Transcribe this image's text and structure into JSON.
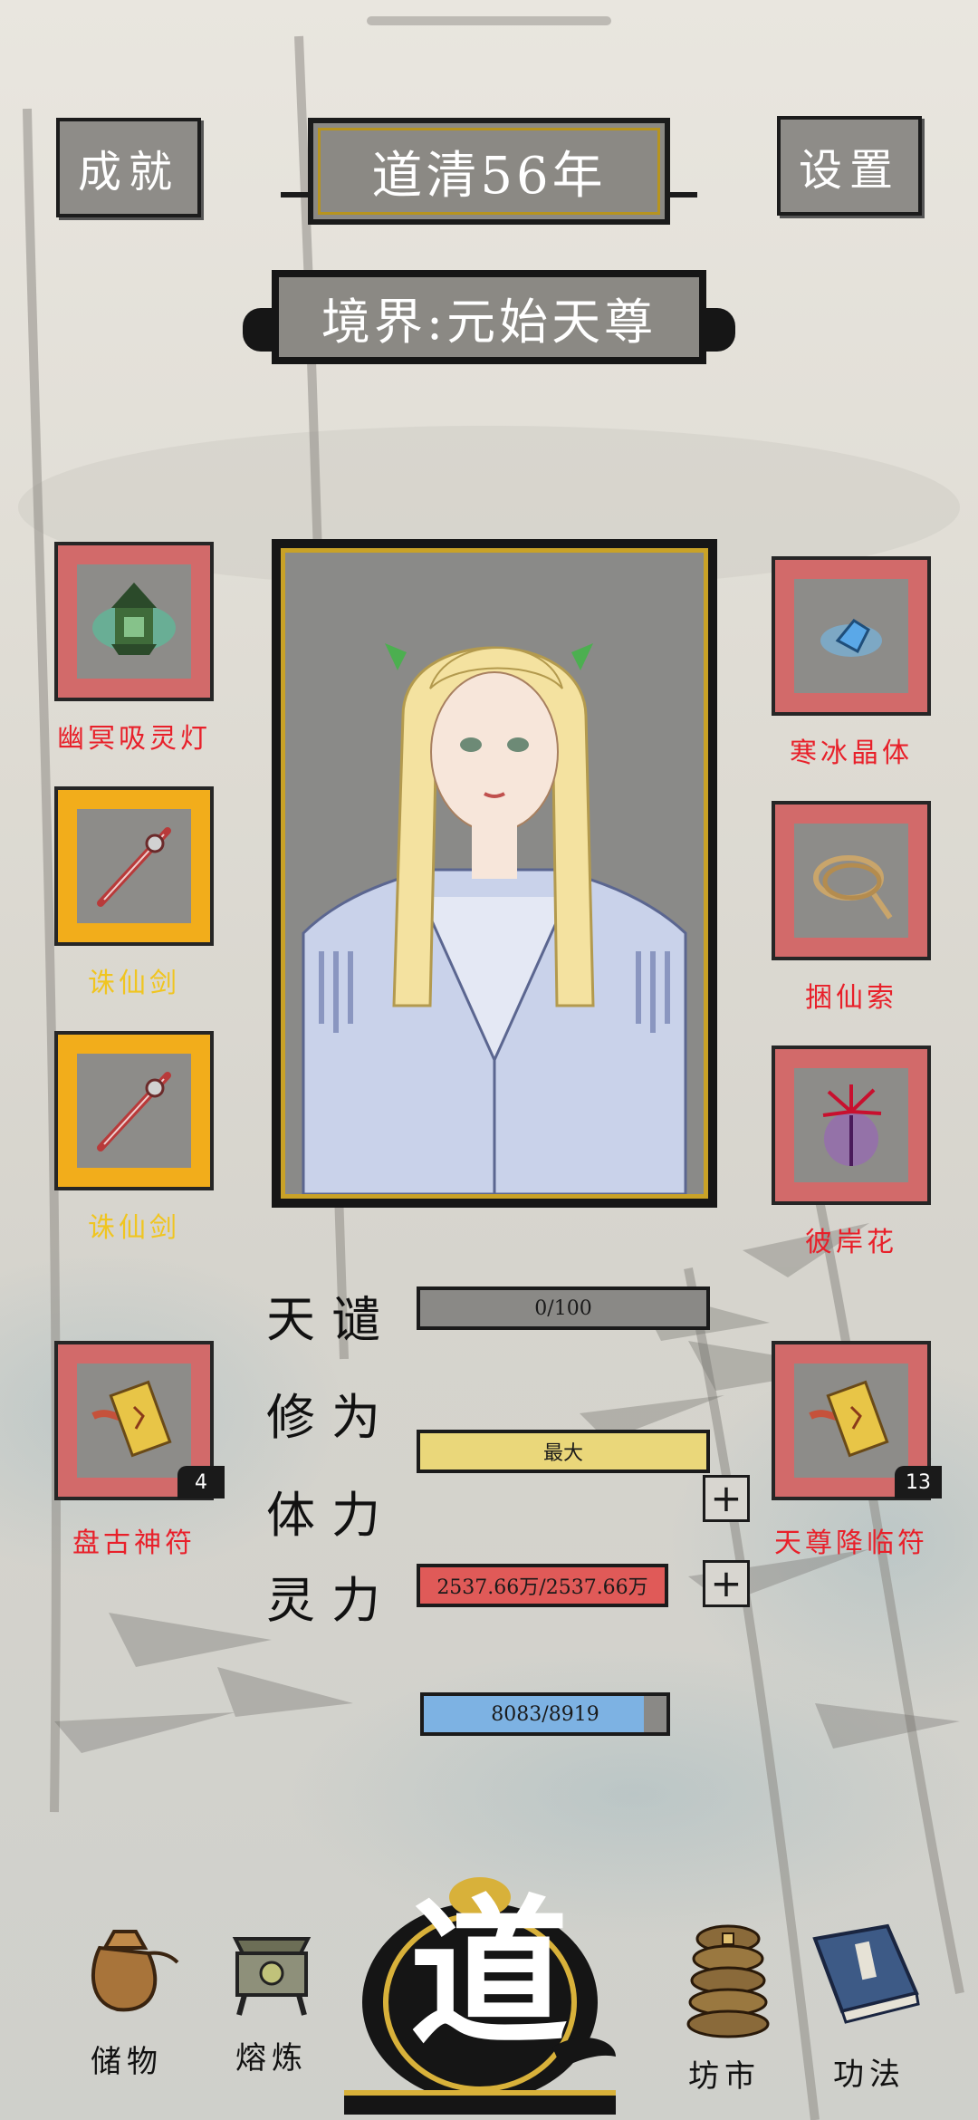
{
  "header": {
    "achievements_label": "成就",
    "year_title": "道清56年",
    "settings_label": "设置",
    "realm_title": "境界:元始天尊"
  },
  "left_items": [
    {
      "label": "幽冥吸灵灯",
      "frame": "red",
      "icon": "lantern-icon"
    },
    {
      "label": "诛仙剑",
      "frame": "gold",
      "icon": "sword-icon"
    },
    {
      "label": "诛仙剑",
      "frame": "gold",
      "icon": "sword-icon"
    },
    {
      "label": "盘古神符",
      "frame": "red",
      "icon": "talisman-icon",
      "count": "4"
    }
  ],
  "right_items": [
    {
      "label": "寒冰晶体",
      "frame": "red",
      "icon": "ice-crystal-icon"
    },
    {
      "label": "捆仙索",
      "frame": "red",
      "icon": "rope-icon"
    },
    {
      "label": "彼岸花",
      "frame": "red",
      "icon": "flower-icon"
    },
    {
      "label": "天尊降临符",
      "frame": "red",
      "icon": "talisman-icon",
      "count": "13"
    }
  ],
  "stats": [
    {
      "label": "天谴",
      "value_text": "0/100",
      "fill": 0.0,
      "color": "#8a8986"
    },
    {
      "label": "修为",
      "value_text": "最大",
      "fill": 1.0,
      "color": "#ead77a"
    },
    {
      "label": "体力",
      "value_text": "2537.66万/2537.66万",
      "fill": 1.0,
      "color": "#e05a58"
    },
    {
      "label": "灵力",
      "value_text": "8083/8919",
      "fill": 0.906,
      "color": "#7db2e3"
    }
  ],
  "plus_label": "+",
  "nav": {
    "storage": "储物",
    "smelt": "熔炼",
    "dao": "道",
    "market": "坊市",
    "skills": "功法"
  },
  "colors": {
    "item_red": "#d26a6a",
    "item_gold": "#f2ad1b",
    "label_red": "#e8202a",
    "label_gold": "#f0c520"
  }
}
